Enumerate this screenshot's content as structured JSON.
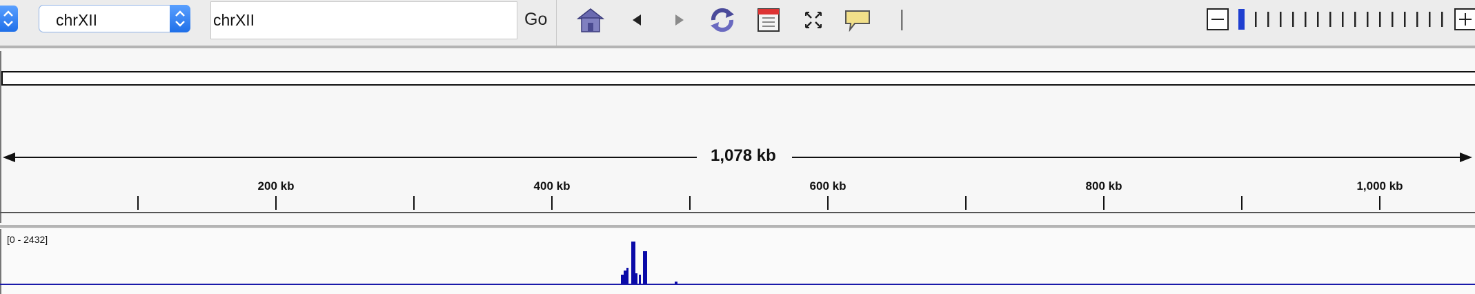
{
  "toolbar": {
    "chromosome_select_value": "chrXII",
    "locus_value": "chrXII",
    "go_label": "Go",
    "icons": [
      "home-icon",
      "back-arrow-icon",
      "forward-arrow-icon",
      "refresh-icon",
      "region-of-interest-icon",
      "fit-to-window-icon",
      "popup-info-icon",
      "resize-handle-icon"
    ]
  },
  "zoom": {
    "minus_icon": "zoom-out-icon",
    "plus_icon": "zoom-in-icon",
    "current_level": 0
  },
  "ruler": {
    "span_label": "1,078 kb",
    "labels": [
      "200 kb",
      "400 kb",
      "600 kb",
      "800 kb",
      "1,000 kb"
    ]
  },
  "track": {
    "data_range": "[0 - 2432]",
    "color": "#0a0aa8"
  }
}
